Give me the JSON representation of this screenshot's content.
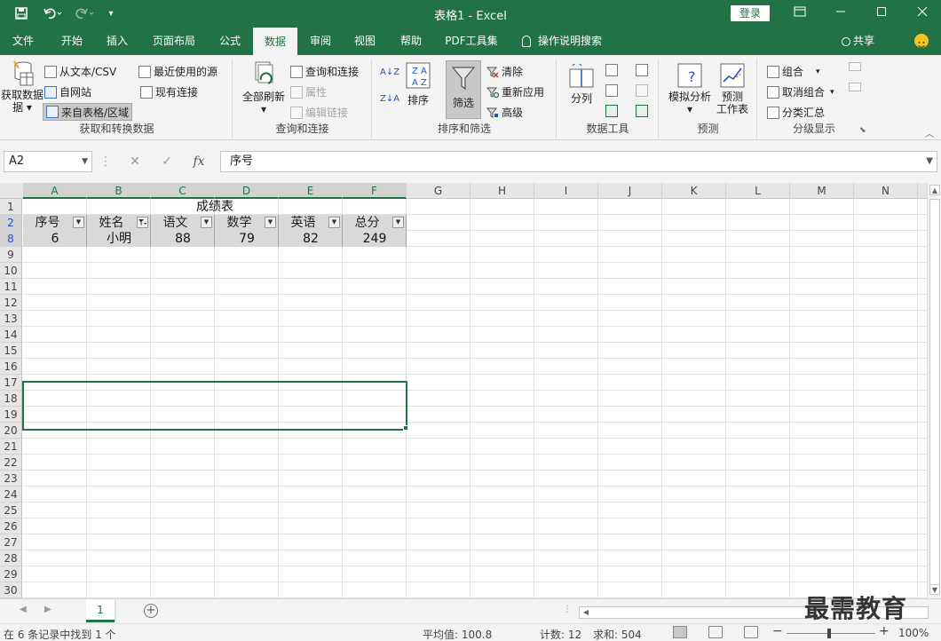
{
  "titlebar": {
    "title": "表格1  -  Excel",
    "login_label": "登录",
    "save_icon": "save-icon",
    "undo_icon": "undo-icon",
    "redo_icon": "redo-icon",
    "customize_icon": "customize-qat-icon",
    "ribbon_display_icon": "ribbon-display-icon",
    "minimize_icon": "minimize-icon",
    "restore_icon": "maximize-icon",
    "close_icon": "close-icon"
  },
  "tabs": [
    "文件",
    "开始",
    "插入",
    "页面布局",
    "公式",
    "数据",
    "审阅",
    "视图",
    "帮助",
    "PDF工具集"
  ],
  "active_tab": "数据",
  "tell_me": "操作说明搜索",
  "share": "共享",
  "ribbon": {
    "get_transform": {
      "get_data": "获取数据",
      "get_data_2": "据",
      "from_text_csv": "从文本/CSV",
      "from_web": "自网站",
      "from_table": "来自表格/区域",
      "recent_sources": "最近使用的源",
      "existing_connections": "现有连接",
      "label": "获取和转换数据"
    },
    "queries": {
      "refresh_all": "全部刷新",
      "queries_connections": "查询和连接",
      "properties": "属性",
      "edit_links": "编辑链接",
      "label": "查询和连接"
    },
    "sort_filter": {
      "sort_az": "A↓Z",
      "sort_za": "Z↓A",
      "sort": "排序",
      "filter": "筛选",
      "clear": "清除",
      "reapply": "重新应用",
      "advanced": "高级",
      "label": "排序和筛选"
    },
    "data_tools": {
      "text_to_columns": "分列",
      "label": "数据工具"
    },
    "forecast": {
      "what_if": "模拟分析",
      "forecast_sheet": "预测",
      "forecast_sheet_2": "工作表",
      "label": "预测"
    },
    "outline": {
      "group": "组合",
      "ungroup": "取消组合",
      "subtotal": "分类汇总",
      "label": "分级显示"
    }
  },
  "formula_bar": {
    "name_box": "A2",
    "formula": "序号",
    "fx": "fx",
    "cancel": "✕",
    "enter": "✓"
  },
  "grid": {
    "columns": [
      "A",
      "B",
      "C",
      "D",
      "E",
      "F",
      "G",
      "H",
      "I",
      "J",
      "K",
      "L",
      "M",
      "N"
    ],
    "row_numbers": [
      "1",
      "2",
      "8",
      "9",
      "10",
      "11",
      "12",
      "13",
      "14",
      "15",
      "16",
      "17",
      "18",
      "19",
      "20",
      "21",
      "22",
      "23",
      "24",
      "25",
      "26",
      "27",
      "28",
      "29",
      "30"
    ],
    "title": "成绩表",
    "headers": [
      "序号",
      "姓名",
      "语文",
      "数学",
      "英语",
      "总分"
    ],
    "rows": [
      [
        "6",
        "小明",
        "88",
        "79",
        "82",
        "249"
      ]
    ],
    "filtered_column": "姓名"
  },
  "sheet_tabs": [
    "1"
  ],
  "watermark": "最需教育",
  "status": {
    "message": "在 6 条记录中找到 1 个",
    "average": "平均值: 100.8",
    "count": "计数: 12",
    "sum": "求和: 504",
    "zoom": "100%",
    "zoom_level": 100
  },
  "colors": {
    "brand": "#217346",
    "ribbon_bg": "#f3f3f3",
    "table_header_bg": "#d9d9d9"
  }
}
